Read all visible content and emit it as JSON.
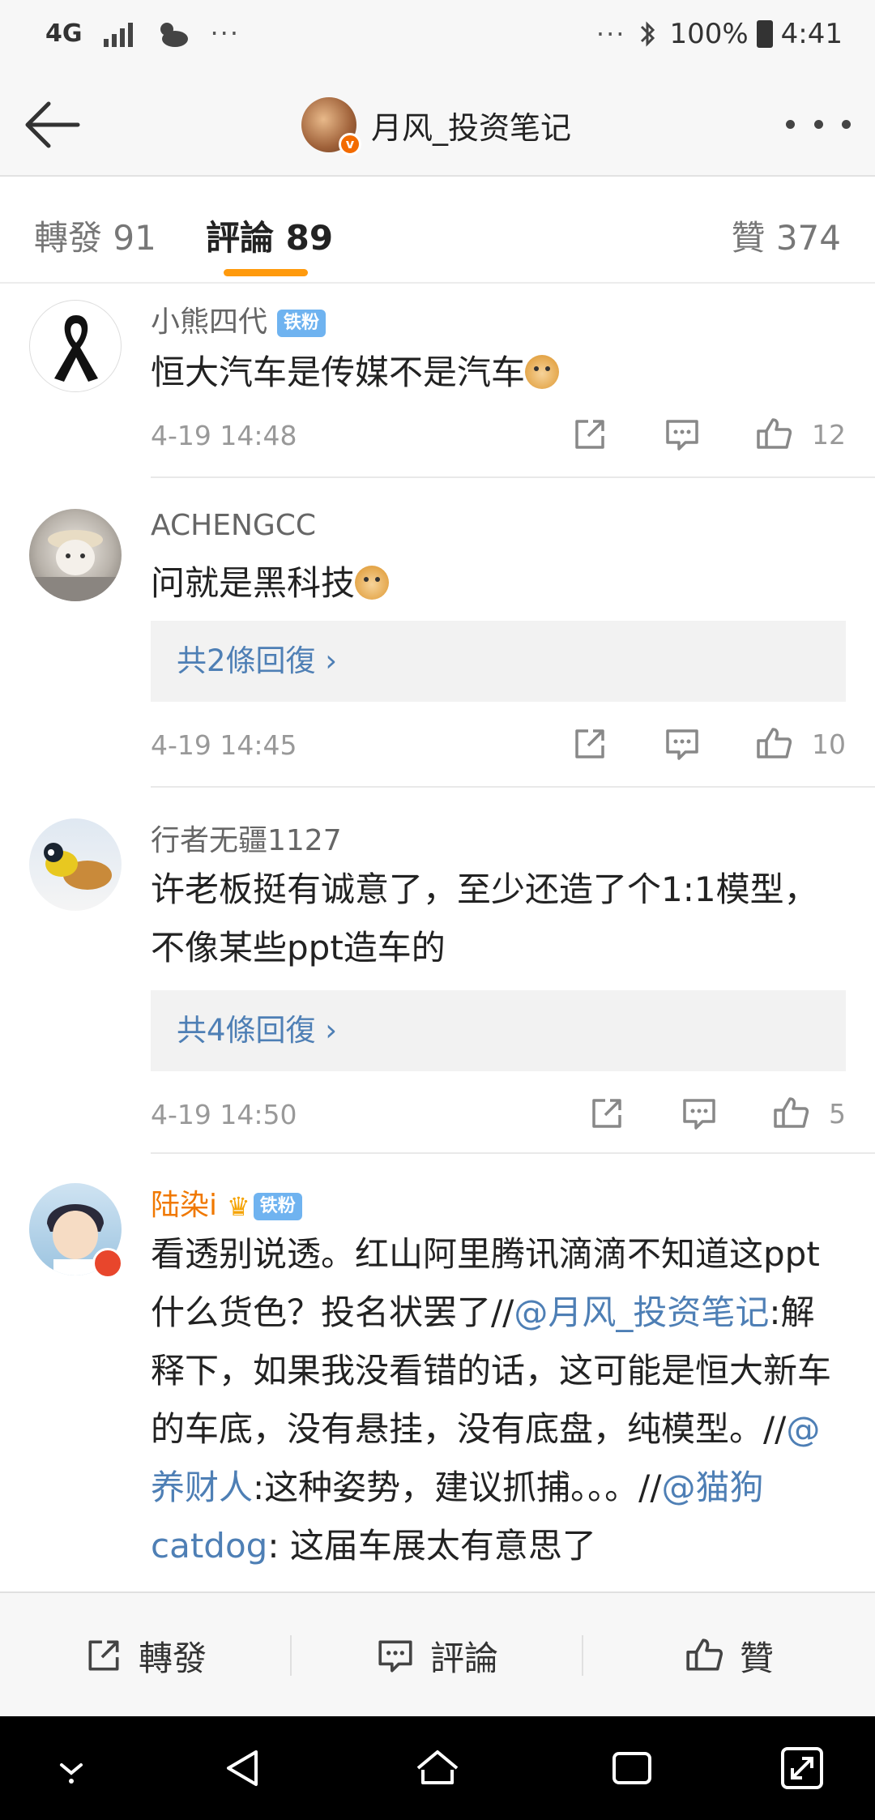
{
  "status_bar": {
    "network": "4G",
    "more": "···",
    "more_right": "···",
    "battery": "100%",
    "time": "4:41"
  },
  "nav": {
    "title": "月风_投资笔记",
    "verified": "v"
  },
  "tabs": [
    {
      "label": "轉發 91"
    },
    {
      "label": "評論 89"
    },
    {
      "label": "贊 374"
    }
  ],
  "comments": [
    {
      "user": "小熊四代",
      "badge": "铁粉",
      "text": "恒大汽车是传媒不是汽车",
      "time": "4-19 14:48",
      "likes": "12"
    },
    {
      "user": "ACHENGCC",
      "text": "问就是黑科技",
      "replies": "共2條回復 ›",
      "time": "4-19 14:45",
      "likes": "10"
    },
    {
      "user": "行者无疆1127",
      "text": "许老板挺有诚意了，至少还造了个1:1模型，不像某些ppt造车的",
      "replies": "共4條回復 ›",
      "time": "4-19 14:50",
      "likes": "5"
    },
    {
      "user": "陆染i",
      "badge": "铁粉",
      "text_parts": [
        "看透别说透。红山阿里腾讯滴滴不知道这ppt什么货色？投名状罢了//",
        "@月风_投资笔记",
        ":解释下，如果我没看错的话，这可能是恒大新车的车底，没有悬挂，没有底盘，纯模型。//",
        "@养财人",
        ":这种姿势，建议抓捕。。。//",
        "@猫狗catdog",
        ": 这届车展太有意思了"
      ]
    }
  ],
  "bottom_bar": {
    "repost": "轉發",
    "comment": "評論",
    "like": "贊"
  },
  "colors": {
    "accent": "#ff9a0d",
    "link": "#4e7fb5",
    "vip_name": "#f07800",
    "fan_badge": "#6fb3f0"
  }
}
